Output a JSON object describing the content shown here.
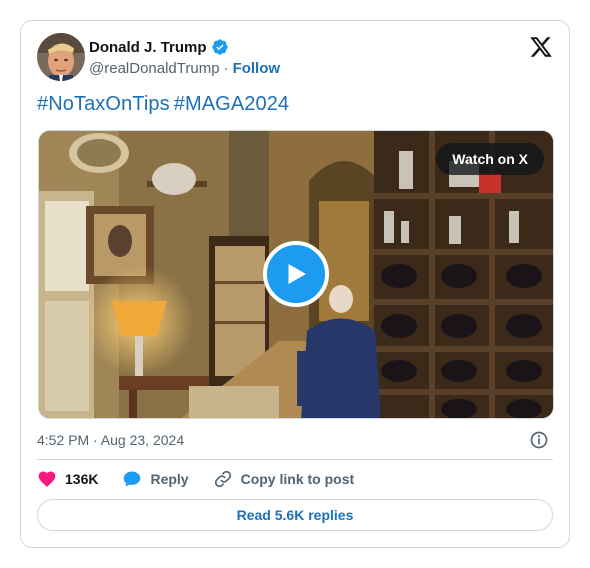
{
  "author": {
    "display_name": "Donald J. Trump",
    "handle": "@realDonaldTrump",
    "separator": "·",
    "follow_label": "Follow",
    "verified_color": "#1d9bf0"
  },
  "tweet": {
    "hashtags": [
      "#NoTaxOnTips",
      "#MAGA2024"
    ]
  },
  "media": {
    "watch_label": "Watch on X",
    "play_icon": "play-icon"
  },
  "meta": {
    "timestamp": "4:52 PM · Aug 23, 2024"
  },
  "actions": {
    "likes_count": "136K",
    "reply_label": "Reply",
    "copy_link_label": "Copy link to post"
  },
  "footer": {
    "read_replies_label": "Read 5.6K replies"
  },
  "colors": {
    "link": "#1d70b8",
    "heart": "#f91880",
    "reply": "#1d9bf0",
    "play": "#1d9bf0",
    "border": "#cfd9de",
    "muted": "#536471"
  }
}
